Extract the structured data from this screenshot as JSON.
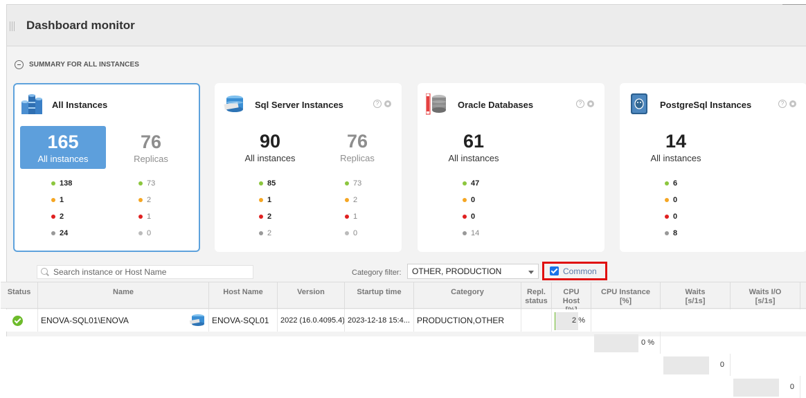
{
  "header": {
    "title": "Dashboard monitor"
  },
  "summary": {
    "label": "SUMMARY FOR ALL INSTANCES"
  },
  "colors": {
    "ok": "#8cc63e",
    "warning": "#f5a623",
    "critical": "#e02020",
    "unknown": "#999999",
    "accent": "#5d9fdc"
  },
  "cards": {
    "all": {
      "title": "All Instances",
      "primary_num": "165",
      "primary_label": "All instances",
      "secondary_num": "76",
      "secondary_label": "Replicas",
      "primary_stats": [
        "138",
        "1",
        "2",
        "24"
      ],
      "secondary_stats": [
        "73",
        "2",
        "1",
        "0"
      ]
    },
    "sqlserver": {
      "title": "Sql Server Instances",
      "primary_num": "90",
      "primary_label": "All instances",
      "secondary_num": "76",
      "secondary_label": "Replicas",
      "primary_stats": [
        "85",
        "1",
        "2",
        "2"
      ],
      "secondary_stats": [
        "73",
        "2",
        "1",
        "0"
      ]
    },
    "oracle": {
      "title": "Oracle Databases",
      "primary_num": "61",
      "primary_label": "All instances",
      "primary_stats": [
        "47",
        "0",
        "0",
        "14"
      ]
    },
    "postgres": {
      "title": "PostgreSql Instances",
      "primary_num": "14",
      "primary_label": "All instances",
      "primary_stats": [
        "6",
        "0",
        "0",
        "8"
      ]
    }
  },
  "toolbar": {
    "search_placeholder": "Search instance or Host Name",
    "category_label": "Category filter:",
    "category_value": "OTHER, PRODUCTION",
    "common_label": "Common",
    "common_checked": true
  },
  "table": {
    "headers": {
      "status": "Status",
      "name": "Name",
      "host": "Host Name",
      "version": "Version",
      "startup": "Startup time",
      "category": "Category",
      "repl": "Repl.\nstatus",
      "cpu_host": "CPU\nHost\n[%]",
      "cpu_instance": "CPU Instance\n[%]",
      "waits": "Waits\n[s/1s]",
      "waits_io": "Waits I/O\n[s/1s]"
    },
    "rows": [
      {
        "name": "ENOVA-SQL01\\ENOVA",
        "host": "ENOVA-SQL01",
        "version": "2022 (16.0.4095.4)",
        "startup": "2023-12-18 15:4...",
        "category": "PRODUCTION,OTHER",
        "repl": "",
        "cpu_host": "2 %",
        "cpu_host_fraction": 0.02,
        "cpu_instance": "0 %",
        "waits": "0",
        "waits_io": "0"
      }
    ]
  }
}
